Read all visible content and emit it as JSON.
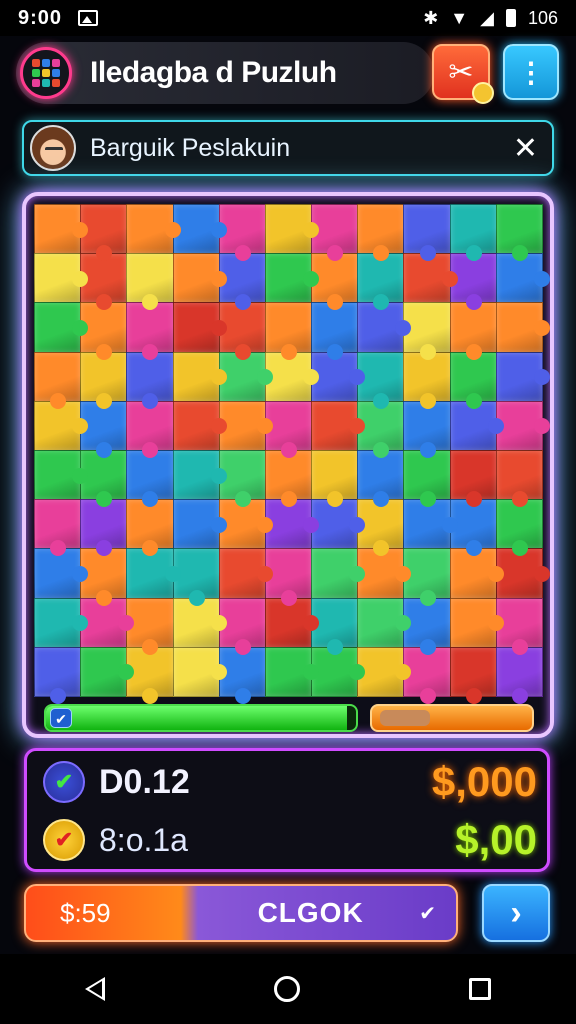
{
  "status_bar": {
    "time": "9:00",
    "right_text": "106"
  },
  "header": {
    "title": "Iledagba d Puzluh",
    "icon": "puzzle-grid-icon"
  },
  "banner": {
    "name": "Barguik Peslakuin"
  },
  "board": {
    "rows": 10,
    "cols": 11,
    "palette": [
      "#2f7ee8",
      "#e84a2f",
      "#2fc84f",
      "#f2c42a",
      "#8a3fe0",
      "#ff8a2a",
      "#1fb8b0",
      "#e83f9a",
      "#4f5fe8",
      "#d9362a",
      "#3fd06a",
      "#f5e04a"
    ],
    "progress": 0.97
  },
  "stats": {
    "row1": {
      "label": "D0.12",
      "value": "$,000"
    },
    "row2": {
      "label": "8:o.1a",
      "value": "$,00"
    }
  },
  "action": {
    "price": "$:59",
    "label": "CLGOK"
  },
  "colors": {
    "accent_purple": "#cf4cff",
    "accent_cyan": "#3fd8e8",
    "accent_orange": "#ff6a2a"
  }
}
